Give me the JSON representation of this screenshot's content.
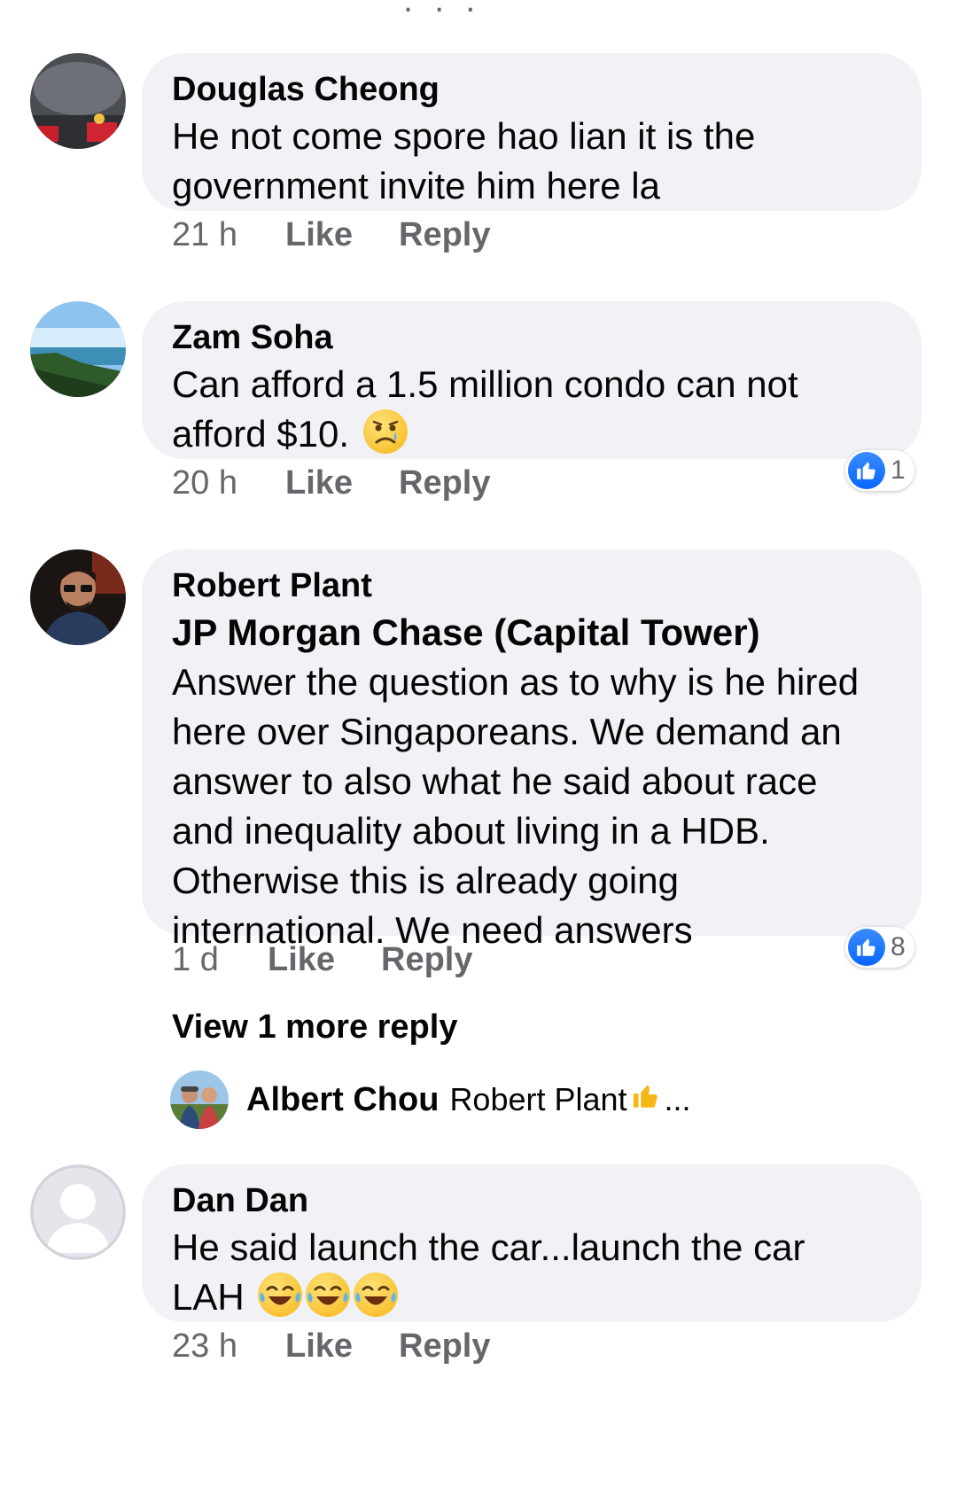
{
  "top_partial": "...",
  "comments": [
    {
      "author": "Douglas Cheong",
      "lines": [
        "He not come spore hao lian it is the",
        "government invite him here la"
      ],
      "time": "21 h",
      "like_label": "Like",
      "reply_label": "Reply"
    },
    {
      "author": "Zam Soha",
      "lines": [
        "Can afford a 1.5 million condo can not",
        "afford $10."
      ],
      "time": "20 h",
      "like_label": "Like",
      "reply_label": "Reply",
      "reaction_count": "1"
    },
    {
      "author": "Robert Plant",
      "tag": "JP Morgan Chase (Capital Tower)",
      "lines": [
        "Answer the question as to why is he hired",
        "here over Singaporeans. We demand an",
        "answer to also what he said about race",
        "and inequality about living in a HDB.",
        "Otherwise this is already going",
        "international. We need answers"
      ],
      "time": "1 d",
      "like_label": "Like",
      "reply_label": "Reply",
      "reaction_count": "8",
      "view_more": "View 1 more reply",
      "reply_preview": {
        "author": "Albert Chou",
        "text": "Robert Plant",
        "ellipsis": "..."
      }
    },
    {
      "author": "Dan Dan",
      "lines": [
        "He said launch the car...launch the car",
        "LAH"
      ],
      "time": "23 h",
      "like_label": "Like",
      "reply_label": "Reply"
    }
  ],
  "colors": {
    "bubble": "#f0f2f5",
    "meta": "#65676b",
    "like_blue": "#0866ff"
  },
  "icons": [
    "like-reaction-icon",
    "sad-tear-emoji-icon",
    "laughing-tears-emoji-icon",
    "thumbs-up-emoji-icon"
  ]
}
